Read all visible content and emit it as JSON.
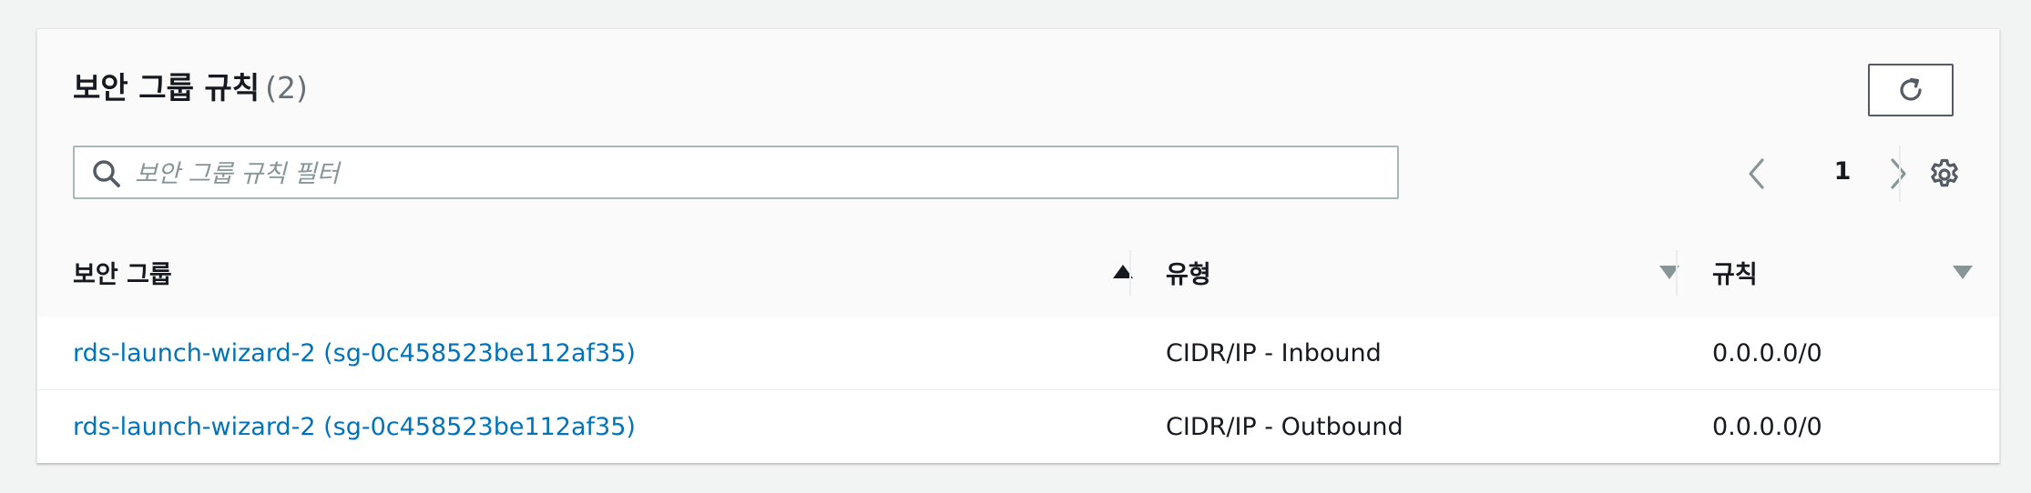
{
  "panel": {
    "title": "보안 그룹 규칙",
    "count": "(2)"
  },
  "search": {
    "placeholder": "보안 그룹 규칙 필터",
    "value": ""
  },
  "pagination": {
    "current_page": "1"
  },
  "table": {
    "columns": [
      {
        "label": "보안 그룹",
        "sort": "ascending"
      },
      {
        "label": "유형",
        "sort": "sortable"
      },
      {
        "label": "규칙",
        "sort": "sortable"
      }
    ],
    "rows": [
      {
        "security_group": "rds-launch-wizard-2 (sg-0c458523be112af35)",
        "type": "CIDR/IP - Inbound",
        "rule": "0.0.0.0/0"
      },
      {
        "security_group": "rds-launch-wizard-2 (sg-0c458523be112af35)",
        "type": "CIDR/IP - Outbound",
        "rule": "0.0.0.0/0"
      }
    ]
  },
  "icons": {
    "refresh": "refresh-icon",
    "search": "search-icon",
    "prev": "chevron-left-icon",
    "next": "chevron-right-icon",
    "settings": "gear-icon",
    "sort_asc": "caret-up-icon",
    "sort_desc": "caret-down-icon"
  },
  "colors": {
    "link": "#0073bb",
    "text": "#16191f",
    "muted": "#687078",
    "background": "#f2f3f3"
  }
}
